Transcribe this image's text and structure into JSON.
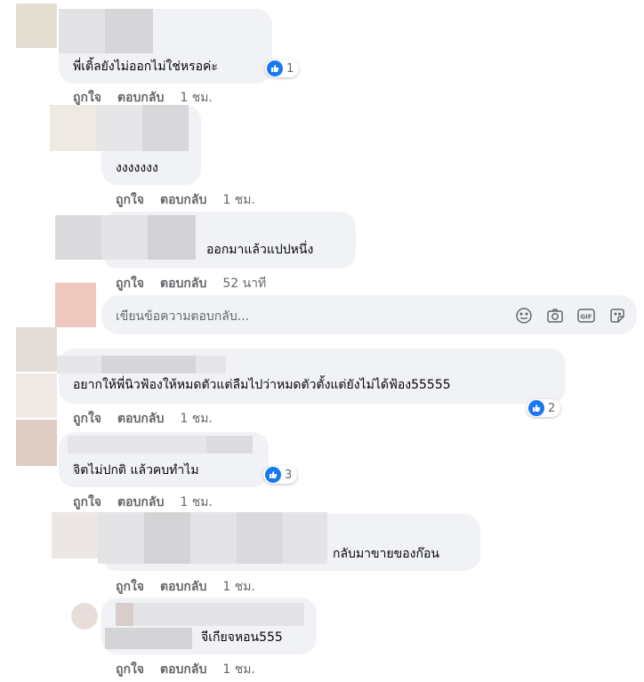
{
  "actions": {
    "like": "ถูกใจ",
    "reply": "ตอบกลับ"
  },
  "comments": [
    {
      "text": "พี่เติ้ลยังไม่ออกไม่ใช่หรอค่ะ",
      "time": "1 ชม.",
      "likes": "1"
    },
    {
      "text": "งงงงงงง",
      "time": "1 ชม."
    },
    {
      "text": "ออกมาแล้วแปปหนึ่ง",
      "time": "52 นาที"
    },
    {
      "text": "อยากให้พี่นิวฟ้องให้หมดตัวแต่ลืมไปว่าหมดตัวตั้งแต่ยังไม่ได้ฟ้อง55555",
      "time": "1 ชม.",
      "likes": "2"
    },
    {
      "text": "จิตไม่ปกติ แล้วคบทำไม",
      "time": "1 ชม.",
      "likes": "3"
    },
    {
      "text": "กลับมาขายของก๊อน",
      "time": "1 ชม."
    },
    {
      "text": "จีเกียจหอน555",
      "time": "1 ชม."
    }
  ],
  "reply_box": {
    "placeholder": "เขียนข้อความตอบกลับ...",
    "tools": [
      "emoji-icon",
      "camera-icon",
      "gif-icon",
      "sticker-icon"
    ]
  },
  "colors": {
    "bubble": "#f0f2f5",
    "like_blue": "#1877f2",
    "meta_gray": "#65676b"
  }
}
